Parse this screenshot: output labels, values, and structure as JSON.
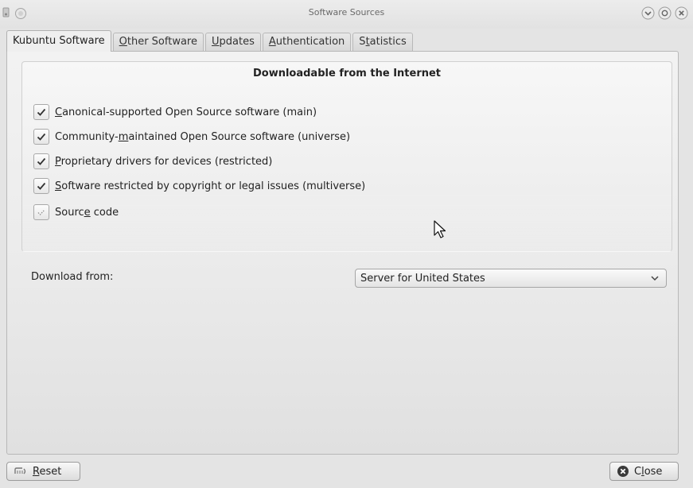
{
  "window": {
    "title": "Software Sources"
  },
  "tabs": [
    {
      "label": "Kubuntu Software",
      "active": true
    },
    {
      "label": "Other Software",
      "accel": "O",
      "rest": "ther Software"
    },
    {
      "label": "Updates",
      "accel": "U",
      "rest": "pdates"
    },
    {
      "label": "Authentication",
      "accel": "A",
      "rest": "uthentication"
    },
    {
      "label": "Statistics",
      "pre": "S",
      "accel": "t",
      "rest": "atistics"
    }
  ],
  "group": {
    "title": "Downloadable from the Internet"
  },
  "components": [
    {
      "label": "Canonical-supported Open Source software (main)",
      "pre": "",
      "accel": "C",
      "rest": "anonical-supported Open Source software (main)",
      "checked": true
    },
    {
      "label": "Community-maintained Open Source software (universe)",
      "pre": "Community-",
      "accel": "m",
      "rest": "aintained Open Source software (universe)",
      "checked": true
    },
    {
      "label": "Proprietary drivers for devices (restricted)",
      "pre": "",
      "accel": "P",
      "rest": "roprietary drivers for devices (restricted)",
      "checked": true
    },
    {
      "label": "Software restricted by copyright or legal issues (multiverse)",
      "pre": "",
      "accel": "S",
      "rest": "oftware restricted by copyright or legal issues (multiverse)",
      "checked": true
    },
    {
      "label": "Source code",
      "pre": "Sourc",
      "accel": "e",
      "rest": " code",
      "checked": "partial"
    }
  ],
  "download": {
    "label": "Download from:",
    "selected": "Server for United States"
  },
  "footer": {
    "reset": {
      "accel": "R",
      "rest": "eset"
    },
    "close": {
      "pre": "C",
      "accel": "l",
      "rest": "ose"
    }
  },
  "icons": {
    "checkbox_checked": "checkmark-icon",
    "checkbox_partial": "partial-check-icon",
    "combo": "chevron-down-icon",
    "reset": "reset-icon",
    "close": "close-circle-icon",
    "cursor": "mouse-pointer-icon"
  }
}
